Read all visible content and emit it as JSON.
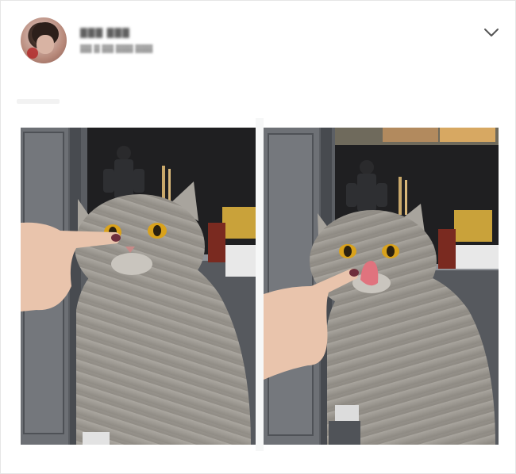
{
  "post": {
    "author_name": "▓▓▓ ▓▓▓",
    "author_meta": "▓▓ ▓ ▓▓ ▓▓▓ ▓▓▓",
    "menu_icon": "chevron-down-icon"
  },
  "images": [
    {
      "subject": "cat-with-finger-on-nose"
    },
    {
      "subject": "cat-licking-finger"
    }
  ],
  "colors": {
    "shelf_dark": "#2b2b2d",
    "cabinet_gray": "#6a6d72",
    "cat_fur": "#a7a39c",
    "cat_eye": "#d9a21c",
    "tongue": "#e0737e",
    "skin": "#e9c4ac"
  }
}
